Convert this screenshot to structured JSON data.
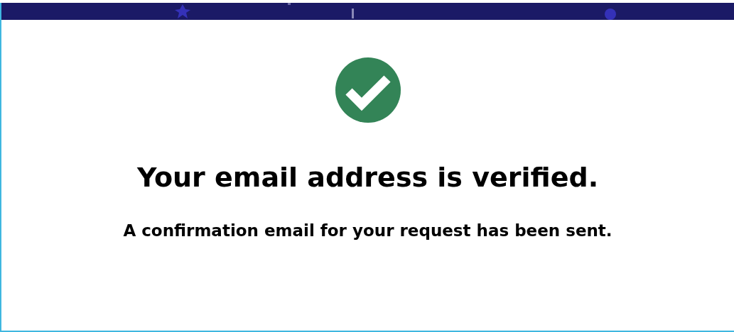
{
  "status": {
    "kind": "success"
  },
  "title": "Your email address is verified.",
  "message": "A confirmation email for your request has been sent."
}
